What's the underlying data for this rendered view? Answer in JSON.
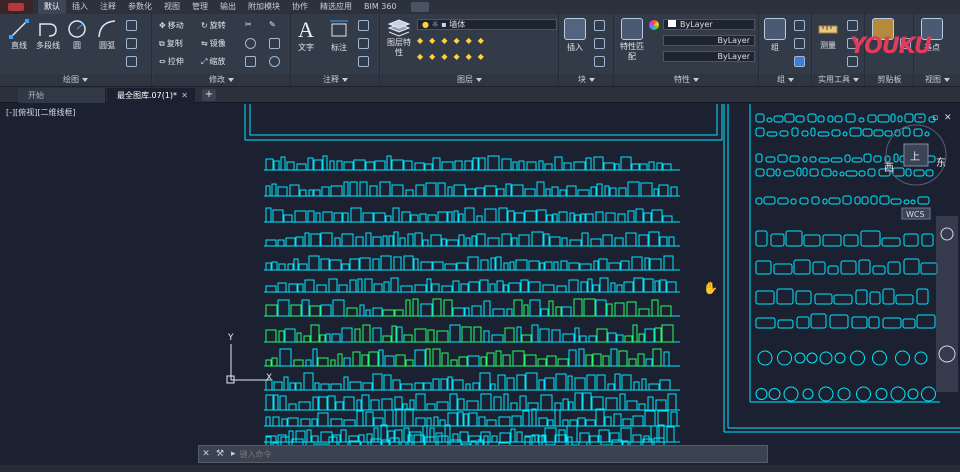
{
  "menubar": {
    "tabs": [
      "默认",
      "插入",
      "注释",
      "参数化",
      "视图",
      "管理",
      "输出",
      "附加模块",
      "协作",
      "精选应用",
      "BIM 360"
    ],
    "active_tab": "默认"
  },
  "ribbon": {
    "draw": {
      "title": "绘图",
      "line": "直线",
      "polyline": "多段线",
      "circle": "圆",
      "arc": "圆弧"
    },
    "modify": {
      "title": "修改",
      "move": "移动",
      "rotate": "旋转",
      "copy": "复制",
      "mirror": "镜像",
      "stretch": "拉伸",
      "scale": "缩放"
    },
    "annotation": {
      "title": "注释",
      "text": "文字",
      "dimension": "标注"
    },
    "layers": {
      "title": "图层",
      "layer_properties": "图层特性",
      "current_layer": "墙体"
    },
    "block": {
      "title": "块",
      "insert": "插入"
    },
    "properties": {
      "title": "特性",
      "match": "特性匹配",
      "color": "ByLayer",
      "linetype": "ByLayer",
      "lineweight": "ByLayer"
    },
    "groups": {
      "title": "组",
      "group": "组"
    },
    "utilities": {
      "title": "实用工具",
      "measure": "测量"
    },
    "clipboard": {
      "title": "剪贴板"
    },
    "view": {
      "title": "视图",
      "base_point": "基点"
    }
  },
  "watermark": {
    "you": "YOU",
    "ku": "KU"
  },
  "file_tabs": {
    "start": "开始",
    "drawing": "最全图库.07(1)*",
    "add": "+"
  },
  "viewport": {
    "label": "[-][俯视][二维线框]",
    "ucs_x": "X",
    "ucs_y": "Y",
    "viewcube_top": "上",
    "viewcube_west": "西",
    "viewcube_east": "东",
    "wcs": "WCS"
  },
  "cmdline": {
    "prompt": "键入命令"
  },
  "colors": {
    "cad_cyan": "#00e8ff",
    "cad_green": "#22ff66",
    "canvas_bg": "#1b2130",
    "ribbon_bg": "#343b48"
  }
}
